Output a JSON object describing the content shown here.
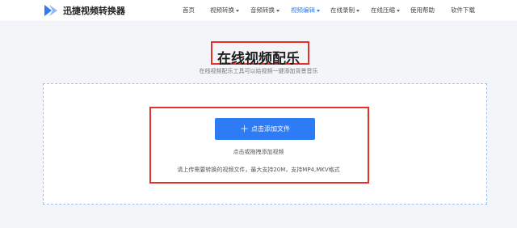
{
  "header": {
    "brand": "迅捷视频转换器",
    "nav": [
      {
        "label": "首页",
        "has_caret": false,
        "active": false
      },
      {
        "label": "视频转换",
        "has_caret": true,
        "active": false
      },
      {
        "label": "音频转换",
        "has_caret": true,
        "active": false
      },
      {
        "label": "视频编辑",
        "has_caret": true,
        "active": true
      },
      {
        "label": "在线录制",
        "has_caret": true,
        "active": false
      },
      {
        "label": "在线压缩",
        "has_caret": true,
        "active": false
      },
      {
        "label": "使用帮助",
        "has_caret": false,
        "active": false
      },
      {
        "label": "软件下载",
        "has_caret": false,
        "active": false
      }
    ]
  },
  "main": {
    "title": "在线视频配乐",
    "subtitle": "在线视频配乐工具可以给视频一键添加背景音乐",
    "upload": {
      "button_label": "点击添加文件",
      "button_icon": "plus-icon",
      "hint": "点击或拖拽添加视频",
      "requirements": "请上传需要转换的视频文件，最大支持20M，支持MP4,MKV格式"
    }
  },
  "colors": {
    "accent": "#2e7bf6",
    "highlight": "#e2322a",
    "background": "#f3f5f9"
  }
}
